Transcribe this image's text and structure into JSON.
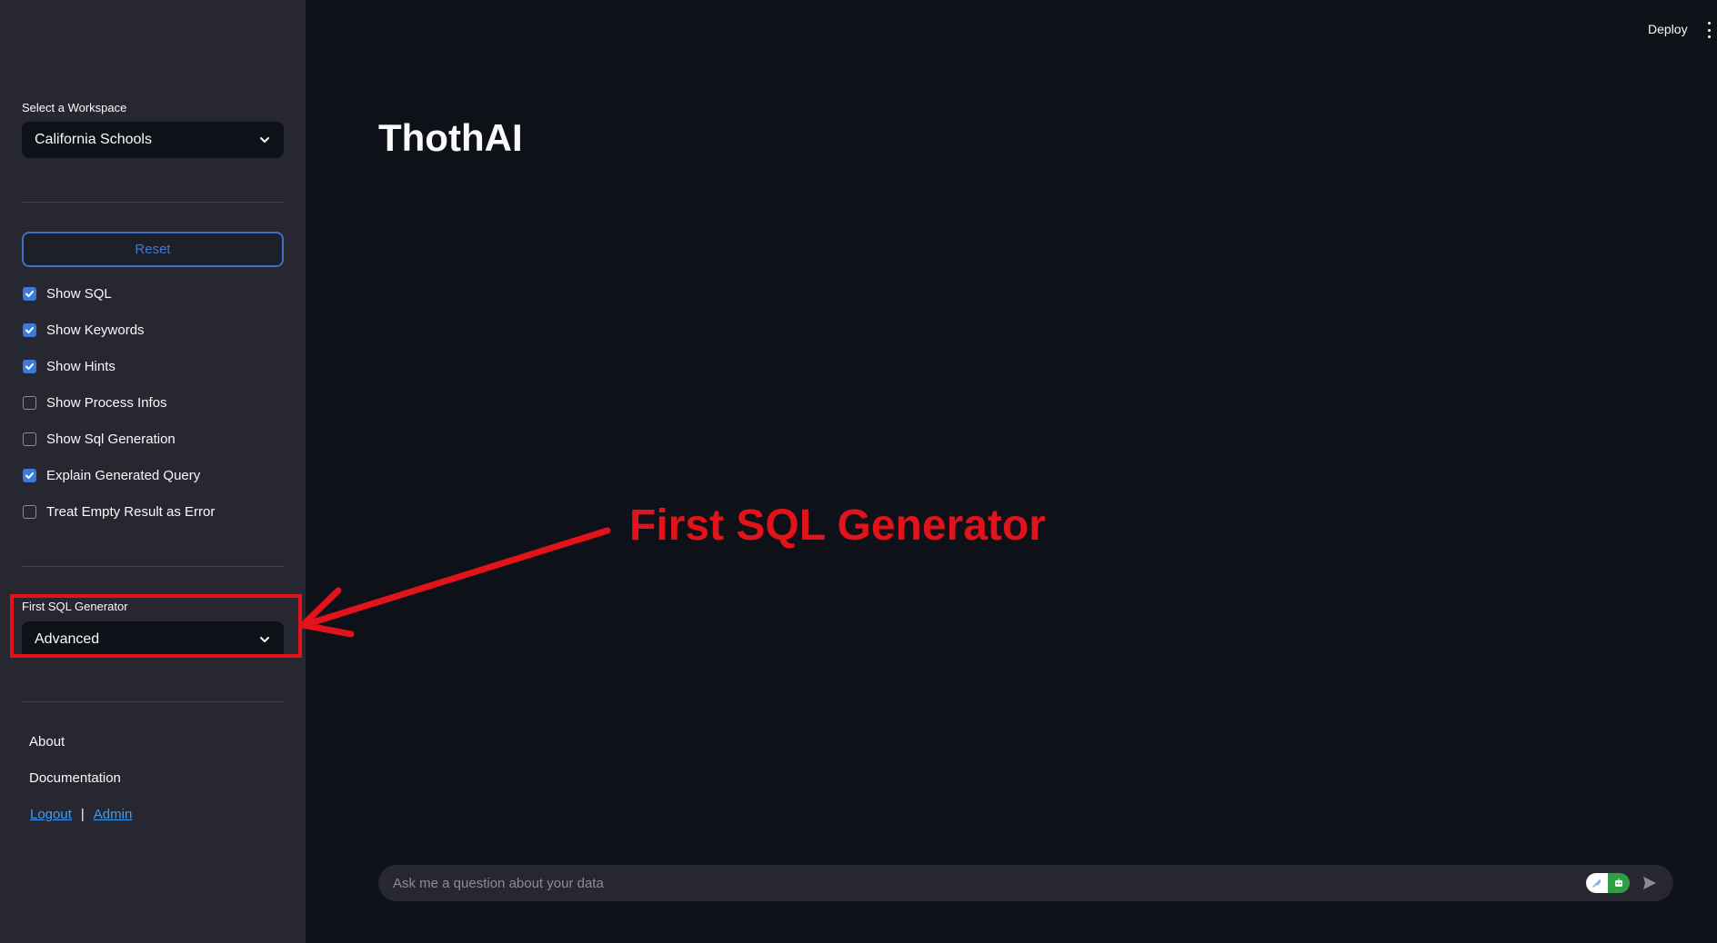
{
  "sidebar": {
    "workspace_label": "Select a Workspace",
    "workspace_value": "California Schools",
    "reset_label": "Reset",
    "checkboxes": [
      {
        "label": "Show SQL",
        "checked": true
      },
      {
        "label": "Show Keywords",
        "checked": true
      },
      {
        "label": "Show Hints",
        "checked": true
      },
      {
        "label": "Show Process Infos",
        "checked": false
      },
      {
        "label": "Show Sql Generation",
        "checked": false
      },
      {
        "label": "Explain Generated Query",
        "checked": true
      },
      {
        "label": "Treat Empty Result as Error",
        "checked": false
      }
    ],
    "generator_label": "First SQL Generator",
    "generator_value": "Advanced",
    "nav": {
      "about": "About",
      "documentation": "Documentation",
      "logout": "Logout",
      "separator": "|",
      "admin": "Admin"
    }
  },
  "header": {
    "deploy_label": "Deploy"
  },
  "main": {
    "title": "ThothAI"
  },
  "chat": {
    "placeholder": "Ask me a question about your data"
  },
  "annotation": {
    "text": "First SQL Generator",
    "color": "#e3131b"
  },
  "colors": {
    "accent": "#3d7ad8",
    "link": "#3d9df6",
    "sidebar_bg": "#262730",
    "main_bg": "#0e1117"
  }
}
